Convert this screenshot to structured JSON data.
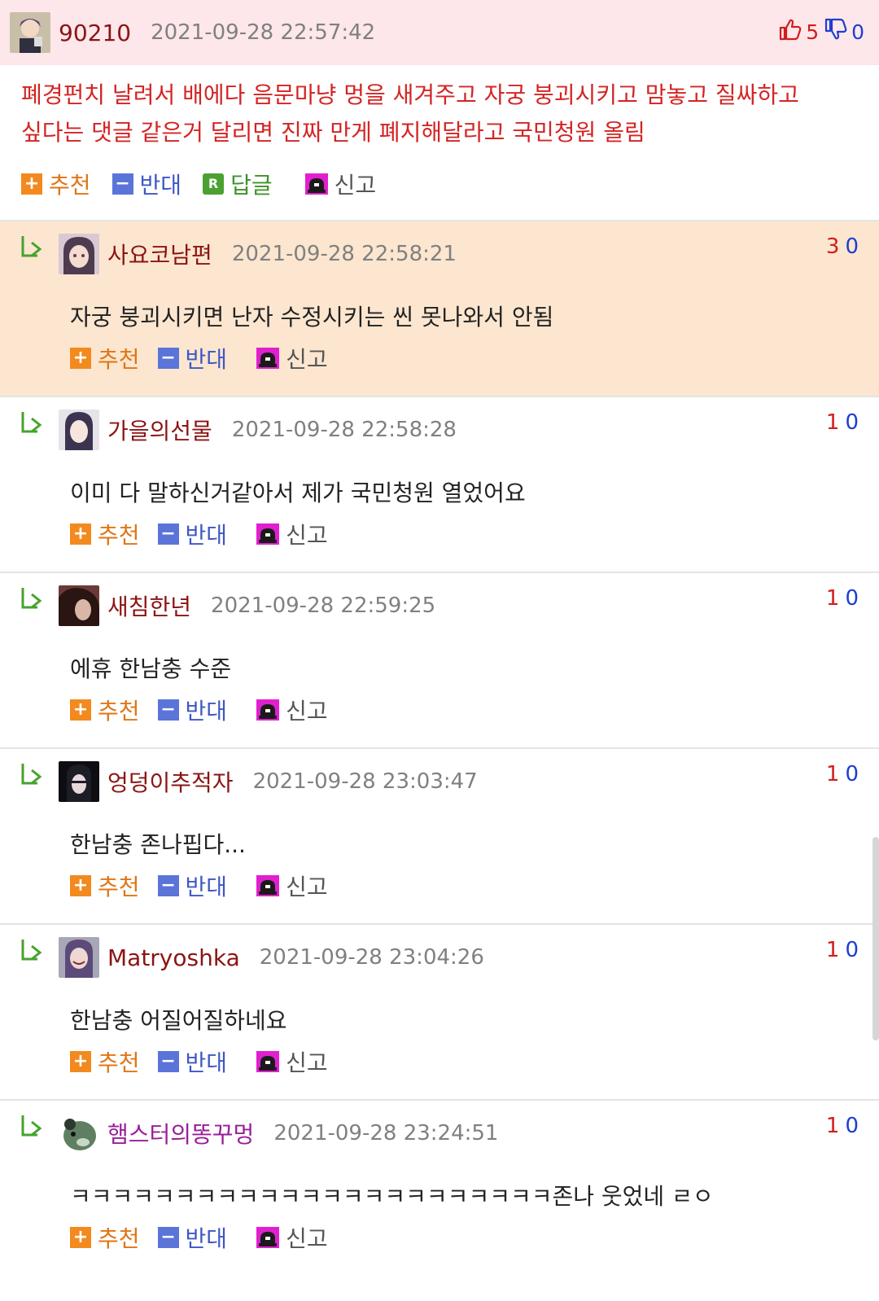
{
  "main_comment": {
    "username": "90210",
    "timestamp": "2021-09-28 22:57:42",
    "upvotes": "5",
    "downvotes": "0",
    "text_line1": "폐경펀치 날려서 배에다 음문마냥 멍을 새겨주고 자궁 붕괴시키고 맘놓고 질싸하고",
    "text_line2": "싶다는 댓글 같은거 달리면 진짜 만게 폐지해달라고 국민청원 올림",
    "actions": {
      "recommend": "추천",
      "oppose": "반대",
      "reply": "답글",
      "report": "신고"
    }
  },
  "action_labels": {
    "recommend": "추천",
    "oppose": "반대",
    "report": "신고"
  },
  "replies": [
    {
      "username": "사요코남편",
      "timestamp": "2021-09-28 22:58:21",
      "up": "3",
      "down": "0",
      "text": "자궁 붕괴시키면 난자 수정시키는 씬 못나와서 안됨"
    },
    {
      "username": "가을의선물",
      "timestamp": "2021-09-28 22:58:28",
      "up": "1",
      "down": "0",
      "text": "이미 다 말하신거같아서 제가 국민청원 열었어요"
    },
    {
      "username": "새침한년",
      "timestamp": "2021-09-28 22:59:25",
      "up": "1",
      "down": "0",
      "text": "에휴 한남충 수준"
    },
    {
      "username": "엉덩이추적자",
      "timestamp": "2021-09-28 23:03:47",
      "up": "1",
      "down": "0",
      "text": "한남충 존나핍다..."
    },
    {
      "username": "Matryoshka",
      "timestamp": "2021-09-28 23:04:26",
      "up": "1",
      "down": "0",
      "text": "한남충 어질어질하네요"
    },
    {
      "username": "햄스터의똥꾸멍",
      "timestamp": "2021-09-28 23:24:51",
      "up": "1",
      "down": "0",
      "text": "ㅋㅋㅋㅋㅋㅋㅋㅋㅋㅋㅋㅋㅋㅋㅋㅋㅋㅋㅋㅋㅋㅋㅋ존나 웃었네 ㄹㅇ"
    }
  ],
  "colors": {
    "header_bg": "#fde7ea",
    "highlight_bg": "#fce6cf",
    "username": "#8b1414",
    "main_text": "#d42424",
    "upvote": "#d11d1d",
    "downvote": "#1d3ed1"
  },
  "icons": [
    "thumbs-up-icon",
    "thumbs-down-icon",
    "plus-icon",
    "minus-icon",
    "reply-badge-icon",
    "siren-icon",
    "reply-arrow-icon",
    "avatar"
  ]
}
